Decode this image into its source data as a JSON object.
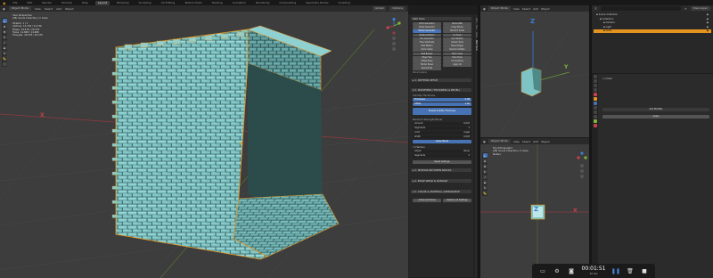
{
  "topbar": {
    "menus": [
      "File",
      "Edit",
      "Render",
      "Window",
      "Help"
    ],
    "workspaces": [
      "Layout",
      "Modeling",
      "Sculpting",
      "UV Editing",
      "Texture Paint",
      "Shading",
      "Animation",
      "Rendering",
      "Compositing",
      "Geometry Nodes",
      "Scripting"
    ],
    "active_workspace": "Layout"
  },
  "main_viewport": {
    "header": {
      "mode": "Object Mode",
      "menus": [
        "View",
        "Select",
        "Add",
        "Object"
      ],
      "transform": "Global",
      "options": "Options"
    },
    "overlay": {
      "view": "User Perspective",
      "collection": "(28) Scene Collection | C Cube",
      "stats": [
        {
          "label": "Objects",
          "value": "1 / 1"
        },
        {
          "label": "Vertices",
          "value": "14,736 / 14,736"
        },
        {
          "label": "Edges",
          "value": "29,376 / 29,376"
        },
        {
          "label": "Faces",
          "value": "14,688 / 14,688"
        },
        {
          "label": "Triangles",
          "value": "29,376 / 29,376"
        }
      ]
    },
    "x_axis_label": "X",
    "tools": [
      "select",
      "cursor",
      "move",
      "rotate",
      "scale",
      "transform",
      "annotate",
      "measure",
      "add-cube"
    ]
  },
  "addon_panel": {
    "title": "Wall Tools",
    "grid_buttons": [
      [
        "Brick Generator",
        "Stone Wall"
      ],
      [
        "Panel Generator",
        "Array Bricks"
      ],
      [
        "Mortar Generator",
        "Random Scale"
      ],
      [
        "Surface Deform",
        "Uv Tools"
      ],
      [
        "Tile Generator",
        "Arch Builder"
      ],
      [
        "Flow Subdivide",
        "Subdiv Tools"
      ],
      [
        "Wall Pattern",
        "Bevel Edges"
      ],
      [
        "Quick Setup",
        "Random Rotate"
      ],
      [
        "Wall Builder",
        "Brick Inset"
      ],
      [
        "Edge Flow",
        "Face Tools"
      ],
      [
        "Offset Rows",
        "Cornerstone"
      ],
      [
        "Mortar Bevel",
        "Apply All"
      ],
      [
        "Randomize",
        ""
      ]
    ],
    "parameters_label": "Parameters",
    "sections": [
      {
        "label": "1. PATTERN SETUP",
        "open": false
      },
      {
        "label": "2. MODIFIERS (THICKNESS & BEVEL)",
        "open": true
      },
      {
        "label": "3. MORTAR BETWEEN BRICKS",
        "open": false
      },
      {
        "label": "4. EDGE WEAR & DAMAGE",
        "open": false
      },
      {
        "label": "5. COLOR & MATERIAL APPEARANCE",
        "open": false
      }
    ],
    "solidify": {
      "label": "Solidify Thickness",
      "thickness_label": "Thickness",
      "thickness": "0.08",
      "offset_label": "Offset",
      "offset": "1.00"
    },
    "enable_button": "Enable Solidify Thickness",
    "bevel_label": "Random Strength Bevel",
    "bevel_values": [
      [
        "Amount",
        "0.001"
      ],
      [
        "Segments",
        "2"
      ],
      [
        "Limit",
        "Angle"
      ],
      [
        "Width",
        "0.003"
      ]
    ],
    "apply_button": "Apply Bevel",
    "checkboxes": [
      {
        "label": "Harden",
        "checked": false
      },
      {
        "label": "Adjust",
        "value": "Bevel"
      },
      {
        "label": "Segments",
        "value": "2"
      }
    ],
    "reset_button": "Reset Settings",
    "bottom_buttons": [
      "Advanced Panel",
      "Restore All Settings"
    ]
  },
  "side_tabs": [
    "Item",
    "Tool",
    "View",
    "Wall Tools"
  ],
  "persp_viewport": {
    "header": {
      "mode": "Object Mode",
      "menus": [
        "View",
        "Select",
        "Add",
        "Object"
      ],
      "transform": "Global"
    },
    "z_label": "Z",
    "y_label": "Y"
  },
  "ortho_viewport": {
    "header": {
      "mode": "Object Mode",
      "menus": [
        "View",
        "Select",
        "Add",
        "Object"
      ],
      "transform": "Global"
    },
    "overlay": {
      "view": "Top Orthographic",
      "collection": "(28) Scene Collection | C Cube",
      "units": "Meters"
    },
    "z_label": "Z",
    "x_label": "X"
  },
  "outliner": {
    "header": {
      "search_placeholder": "",
      "filter": "View Layer"
    },
    "items": [
      {
        "label": "Scene Collection",
        "selected": false,
        "indent": 0
      },
      {
        "label": "Collection",
        "selected": false,
        "indent": 1
      },
      {
        "label": "Camera",
        "selected": false,
        "indent": 2
      },
      {
        "label": "Light",
        "selected": false,
        "indent": 2
      },
      {
        "label": "Cube",
        "selected": true,
        "indent": 2
      }
    ]
  },
  "properties": {
    "object_name": "Cube",
    "section": "Add Modifier",
    "apply": "Apply"
  },
  "dock": {
    "time": "00:01:51",
    "fps": "30 fps"
  },
  "colors": {
    "brick": "#7fc4c4",
    "brick_dark": "#5a9a9a",
    "outline": "#e5951f",
    "accent": "#4772b3",
    "axis_red": "#c8414a",
    "axis_green": "#7fb63a",
    "axis_blue": "#3b7dd8"
  }
}
